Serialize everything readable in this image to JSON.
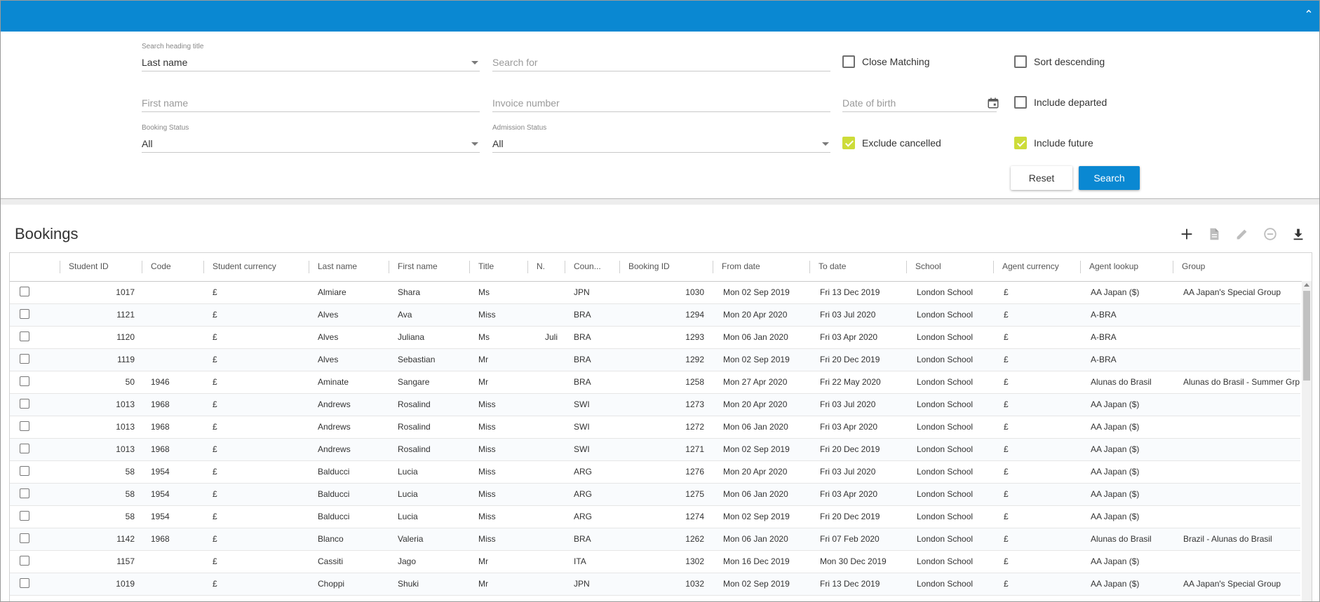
{
  "filters": {
    "search_heading": {
      "label": "Search heading title",
      "value": "Last name"
    },
    "search_for": {
      "placeholder": "Search for"
    },
    "first_name": {
      "placeholder": "First name"
    },
    "invoice_number": {
      "placeholder": "Invoice number"
    },
    "date_of_birth": {
      "placeholder": "Date of birth"
    },
    "booking_status": {
      "label": "Booking Status",
      "value": "All"
    },
    "admission_status": {
      "label": "Admission Status",
      "value": "All"
    },
    "checkboxes": {
      "close_matching": {
        "label": "Close Matching",
        "checked": false
      },
      "sort_descending": {
        "label": "Sort descending",
        "checked": false
      },
      "include_departed": {
        "label": "Include departed",
        "checked": false
      },
      "exclude_cancelled": {
        "label": "Exclude cancelled",
        "checked": true
      },
      "include_future": {
        "label": "Include future",
        "checked": true
      }
    },
    "reset_label": "Reset",
    "search_label": "Search"
  },
  "bookings": {
    "title": "Bookings",
    "toolbar_icons": [
      "add-icon",
      "document-icon",
      "edit-icon",
      "remove-icon",
      "download-icon"
    ],
    "columns": [
      "Student ID",
      "Code",
      "Student currency",
      "Last name",
      "First name",
      "Title",
      "N.",
      "Coun...",
      "Booking ID",
      "From date",
      "To date",
      "School",
      "Agent currency",
      "Agent lookup",
      "Group"
    ],
    "rows": [
      {
        "student_id": "1017",
        "code": "",
        "student_currency": "£",
        "last_name": "Almiare",
        "first_name": "Shara",
        "title": "Ms",
        "n": "",
        "country": "JPN",
        "booking_id": "1030",
        "from_date": "Mon 02 Sep 2019",
        "to_date": "Fri 13 Dec 2019",
        "school": "London School",
        "agent_currency": "£",
        "agent_lookup": "AA Japan ($)",
        "group": "AA Japan's Special Group"
      },
      {
        "student_id": "1121",
        "code": "",
        "student_currency": "£",
        "last_name": "Alves",
        "first_name": "Ava",
        "title": "Miss",
        "n": "",
        "country": "BRA",
        "booking_id": "1294",
        "from_date": "Mon 20 Apr 2020",
        "to_date": "Fri 03 Jul 2020",
        "school": "London School",
        "agent_currency": "£",
        "agent_lookup": "A-BRA",
        "group": ""
      },
      {
        "student_id": "1120",
        "code": "",
        "student_currency": "£",
        "last_name": "Alves",
        "first_name": "Juliana",
        "title": "Ms",
        "n": "Juli",
        "country": "BRA",
        "booking_id": "1293",
        "from_date": "Mon 06 Jan 2020",
        "to_date": "Fri 03 Apr 2020",
        "school": "London School",
        "agent_currency": "£",
        "agent_lookup": "A-BRA",
        "group": ""
      },
      {
        "student_id": "1119",
        "code": "",
        "student_currency": "£",
        "last_name": "Alves",
        "first_name": "Sebastian",
        "title": "Mr",
        "n": "",
        "country": "BRA",
        "booking_id": "1292",
        "from_date": "Mon 02 Sep 2019",
        "to_date": "Fri 20 Dec 2019",
        "school": "London School",
        "agent_currency": "£",
        "agent_lookup": "A-BRA",
        "group": ""
      },
      {
        "student_id": "50",
        "code": "1946",
        "student_currency": "£",
        "last_name": "Aminate",
        "first_name": "Sangare",
        "title": "Mr",
        "n": "",
        "country": "BRA",
        "booking_id": "1258",
        "from_date": "Mon 27 Apr 2020",
        "to_date": "Fri 22 May 2020",
        "school": "London School",
        "agent_currency": "£",
        "agent_lookup": "Alunas do Brasil",
        "group": "Alunas do Brasil - Summer Grp"
      },
      {
        "student_id": "1013",
        "code": "1968",
        "student_currency": "£",
        "last_name": "Andrews",
        "first_name": "Rosalind",
        "title": "Miss",
        "n": "",
        "country": "SWI",
        "booking_id": "1273",
        "from_date": "Mon 20 Apr 2020",
        "to_date": "Fri 03 Jul 2020",
        "school": "London School",
        "agent_currency": "£",
        "agent_lookup": "AA Japan ($)",
        "group": ""
      },
      {
        "student_id": "1013",
        "code": "1968",
        "student_currency": "£",
        "last_name": "Andrews",
        "first_name": "Rosalind",
        "title": "Miss",
        "n": "",
        "country": "SWI",
        "booking_id": "1272",
        "from_date": "Mon 06 Jan 2020",
        "to_date": "Fri 03 Apr 2020",
        "school": "London School",
        "agent_currency": "£",
        "agent_lookup": "AA Japan ($)",
        "group": ""
      },
      {
        "student_id": "1013",
        "code": "1968",
        "student_currency": "£",
        "last_name": "Andrews",
        "first_name": "Rosalind",
        "title": "Miss",
        "n": "",
        "country": "SWI",
        "booking_id": "1271",
        "from_date": "Mon 02 Sep 2019",
        "to_date": "Fri 20 Dec 2019",
        "school": "London School",
        "agent_currency": "£",
        "agent_lookup": "AA Japan ($)",
        "group": ""
      },
      {
        "student_id": "58",
        "code": "1954",
        "student_currency": "£",
        "last_name": "Balducci",
        "first_name": "Lucia",
        "title": "Miss",
        "n": "",
        "country": "ARG",
        "booking_id": "1276",
        "from_date": "Mon 20 Apr 2020",
        "to_date": "Fri 03 Jul 2020",
        "school": "London School",
        "agent_currency": "£",
        "agent_lookup": "AA Japan ($)",
        "group": ""
      },
      {
        "student_id": "58",
        "code": "1954",
        "student_currency": "£",
        "last_name": "Balducci",
        "first_name": "Lucia",
        "title": "Miss",
        "n": "",
        "country": "ARG",
        "booking_id": "1275",
        "from_date": "Mon 06 Jan 2020",
        "to_date": "Fri 03 Apr 2020",
        "school": "London School",
        "agent_currency": "£",
        "agent_lookup": "AA Japan ($)",
        "group": ""
      },
      {
        "student_id": "58",
        "code": "1954",
        "student_currency": "£",
        "last_name": "Balducci",
        "first_name": "Lucia",
        "title": "Miss",
        "n": "",
        "country": "ARG",
        "booking_id": "1274",
        "from_date": "Mon 02 Sep 2019",
        "to_date": "Fri 20 Dec 2019",
        "school": "London School",
        "agent_currency": "£",
        "agent_lookup": "AA Japan ($)",
        "group": ""
      },
      {
        "student_id": "1142",
        "code": "1968",
        "student_currency": "£",
        "last_name": "Blanco",
        "first_name": "Valeria",
        "title": "Miss",
        "n": "",
        "country": "BRA",
        "booking_id": "1262",
        "from_date": "Mon 06 Jan 2020",
        "to_date": "Fri 07 Feb 2020",
        "school": "London School",
        "agent_currency": "£",
        "agent_lookup": "Alunas do Brasil",
        "group": "Brazil - Alunas do Brasil"
      },
      {
        "student_id": "1157",
        "code": "",
        "student_currency": "£",
        "last_name": "Cassiti",
        "first_name": "Jago",
        "title": "Mr",
        "n": "",
        "country": "ITA",
        "booking_id": "1302",
        "from_date": "Mon 16 Dec 2019",
        "to_date": "Mon 30 Dec 2019",
        "school": "London School",
        "agent_currency": "£",
        "agent_lookup": "AA Japan ($)",
        "group": ""
      },
      {
        "student_id": "1019",
        "code": "",
        "student_currency": "£",
        "last_name": "Choppi",
        "first_name": "Shuki",
        "title": "Mr",
        "n": "",
        "country": "JPN",
        "booking_id": "1032",
        "from_date": "Mon 02 Sep 2019",
        "to_date": "Fri 13 Dec 2019",
        "school": "London School",
        "agent_currency": "£",
        "agent_lookup": "AA Japan ($)",
        "group": "AA Japan's Special Group"
      }
    ]
  },
  "colors": {
    "primary": "#0a88d2",
    "check_accent": "#cddc39"
  }
}
